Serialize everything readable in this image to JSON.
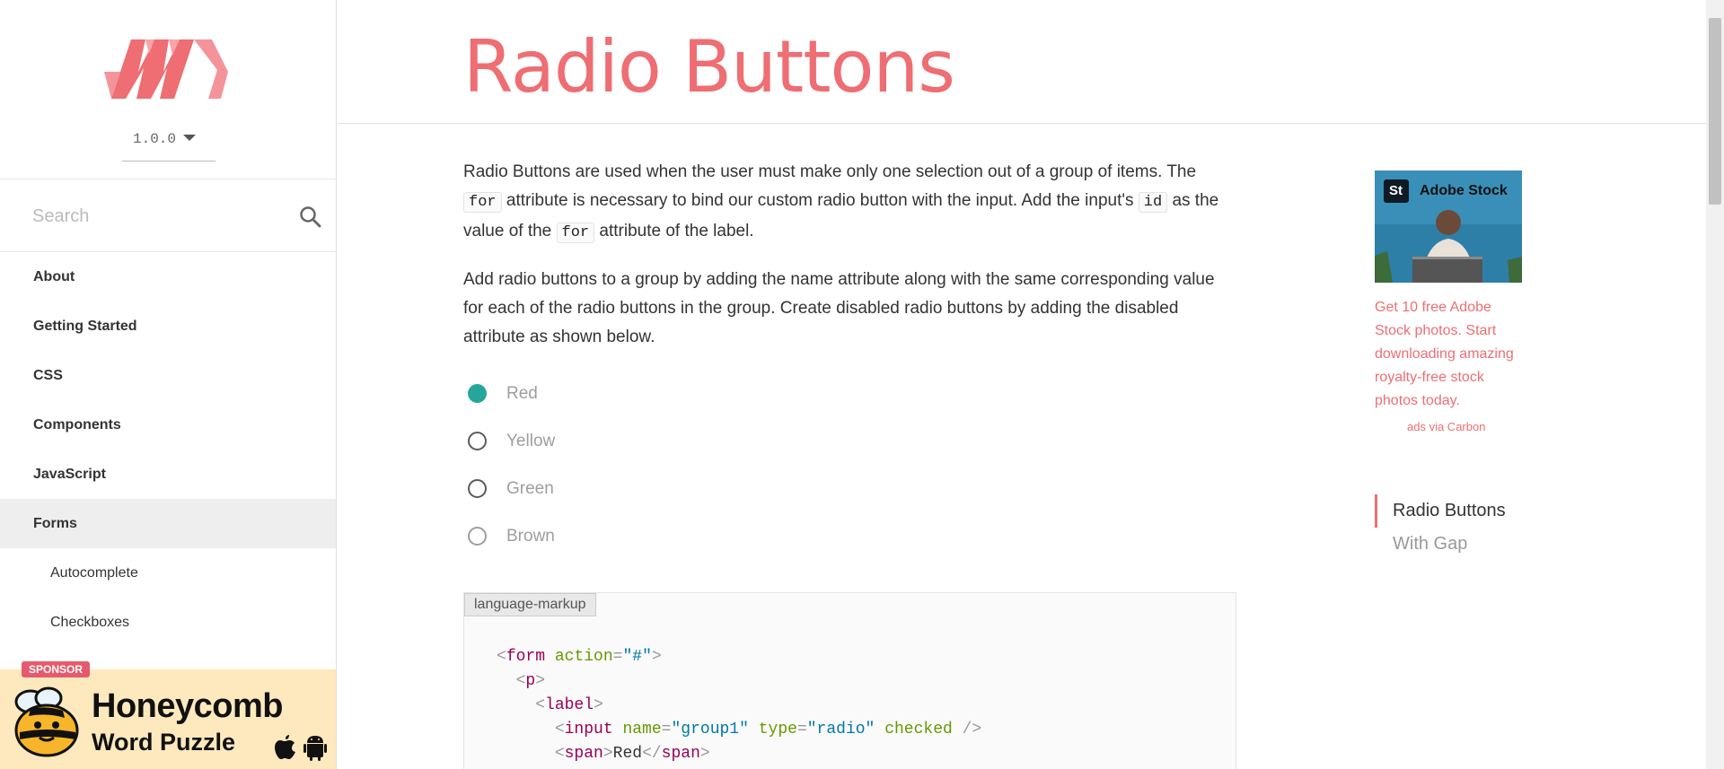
{
  "sidebar": {
    "version": "1.0.0",
    "search_placeholder": "Search",
    "nav": [
      {
        "label": "About"
      },
      {
        "label": "Getting Started"
      },
      {
        "label": "CSS"
      },
      {
        "label": "Components"
      },
      {
        "label": "JavaScript"
      },
      {
        "label": "Forms"
      }
    ],
    "subnav": [
      {
        "label": "Autocomplete"
      },
      {
        "label": "Checkboxes"
      }
    ],
    "sponsor": {
      "badge": "SPONSOR",
      "title1": "Honeycomb",
      "title2": "Word Puzzle"
    }
  },
  "page": {
    "title": "Radio Buttons",
    "p1_a": "Radio Buttons are used when the user must make only one selection out of a group of items. The ",
    "p1_code1": "for",
    "p1_b": " attribute is necessary to bind our custom radio button with the input. Add the input's ",
    "p1_code2": "id",
    "p1_c": " as the value of the ",
    "p1_code3": "for",
    "p1_d": " attribute of the label.",
    "p2": "Add radio buttons to a group by adding the name attribute along with the same corresponding value for each of the radio buttons in the group. Create disabled radio buttons by adding the disabled attribute as shown below.",
    "radios": [
      {
        "label": "Red",
        "checked": true
      },
      {
        "label": "Yellow",
        "checked": false
      },
      {
        "label": "Green",
        "checked": false
      },
      {
        "label": "Brown",
        "checked": false,
        "disabled": true
      }
    ],
    "code_lang": "language-markup",
    "code": {
      "l1_tag": "form",
      "l1_attr": "action",
      "l1_val": "\"#\"",
      "l2_tag": "p",
      "l3_tag": "label",
      "l4_tag": "input",
      "l4_a1": "name",
      "l4_v1": "\"group1\"",
      "l4_a2": "type",
      "l4_v2": "\"radio\"",
      "l4_a3": "checked",
      "l5_tag": "span",
      "l5_text": "Red"
    }
  },
  "ad": {
    "brand": "Adobe Stock",
    "brand_short": "St",
    "text": "Get 10 free Adobe Stock photos. Start downloading amazing royalty-free stock photos today.",
    "via": "ads via Carbon"
  },
  "toc": [
    {
      "label": "Radio Buttons",
      "active": true
    },
    {
      "label": "With Gap",
      "active": false
    }
  ],
  "colors": {
    "accent": "#ee6e73",
    "radio_checked": "#26a69a",
    "sponsor_bg": "#fde9bd"
  }
}
